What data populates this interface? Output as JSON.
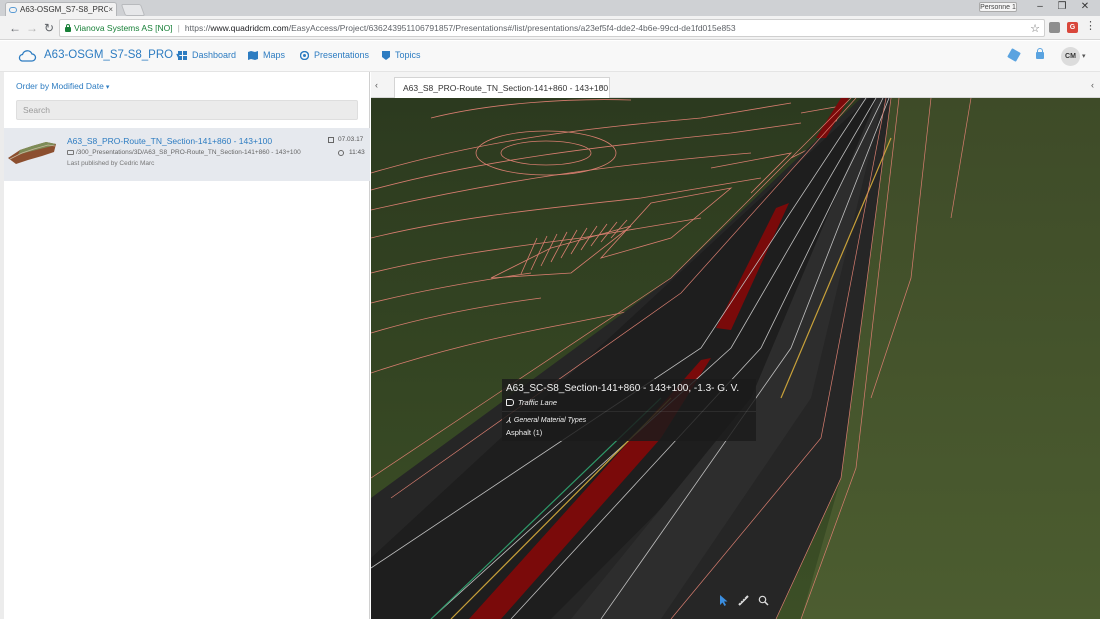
{
  "browser": {
    "tab_title": "A63-OSGM_S7-S8_PRO",
    "tab_close": "×",
    "profile_name": "Personne 1",
    "win_min": "–",
    "win_max": "❐",
    "win_close": "✕",
    "nav_back": "←",
    "nav_forward": "→",
    "nav_reload": "↻",
    "secure_name": "Vianova Systems AS [NO]",
    "omni_sep": "|",
    "url_scheme": "https://",
    "url_host": "www.quadridcm.com",
    "url_path": "/EasyAccess/Project/636243951106791857/Presentations#/list/presentations/a23ef5f4-dde2-4b6e-99cd-de1fd015e853",
    "star": "☆",
    "ext_letter": "G",
    "menu": "⋮"
  },
  "appnav": {
    "project_name": "A63-OSGM_S7-S8_PRO",
    "caret": "▾",
    "links": [
      {
        "label": "Dashboard",
        "icon": "dashboard-icon"
      },
      {
        "label": "Maps",
        "icon": "map-icon"
      },
      {
        "label": "Presentations",
        "icon": "presentation-icon"
      },
      {
        "label": "Topics",
        "icon": "topics-icon"
      }
    ],
    "user_initials": "CM"
  },
  "sidebar": {
    "order_by": "Order by Modified Date",
    "order_caret": "▾",
    "search_placeholder": "Search",
    "presentations": [
      {
        "title": "A63_S8_PRO-Route_TN_Section-141+860 - 143+100",
        "path": "/300_Presentations/3D/A63_S8_PRO-Route_TN_Section-141+860 - 143+100",
        "publisher": "Last published by Cedric Marc",
        "date": "07.03.17",
        "time": "11:43"
      }
    ]
  },
  "viewer": {
    "arrow_left": "‹",
    "arrow_right": "‹",
    "tab_title": "A63_S8_PRO-Route_TN_Section-141+860 - 143+100",
    "tab_close": "×",
    "tooltip": {
      "title": "A63_SC-S8_Section-141+860 - 143+100, -1.3- G. V.",
      "subtype": "Traffic Lane",
      "category": "General Material Types",
      "value": "Asphalt (1)"
    },
    "toolbar": [
      "select-tool-icon",
      "measure-tool-icon",
      "zoom-tool-icon"
    ]
  },
  "colors": {
    "accent": "#2d7cc1",
    "terrain": "#3a4a26",
    "road": "#2b2b2b",
    "lane_red": "#7a0a0a",
    "outline": "#e08070"
  }
}
